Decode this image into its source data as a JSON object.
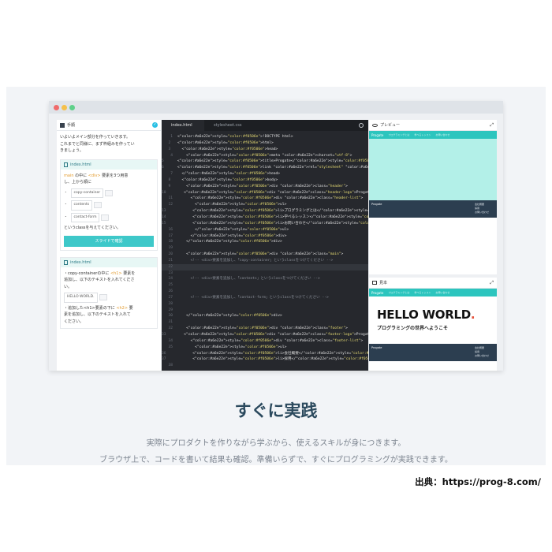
{
  "window": {
    "dots": [
      "#f06b6b",
      "#f5c04a",
      "#5fd08a"
    ]
  },
  "left": {
    "header": "手順",
    "intro": [
      "いよいよメイン部分を作っていきます。",
      "これまでと同様に、まず枠組みを作ってい",
      "きましょう。"
    ],
    "card1": {
      "file": "index.html",
      "line1a": "main",
      "line1b": " の中に ",
      "line1c": "<div>",
      "line1d": " 要素を3つ用意",
      "line2": "し、上から順に",
      "items": [
        "copy-container",
        "contents",
        "contact-form"
      ],
      "after": "というclassを与えてください。",
      "button": "スライドで確認"
    },
    "card2": {
      "file": "index.html",
      "l1a": "・copy-containerの中に ",
      "l1b": "<h1>",
      "l1c": " 要素を",
      "l2": "追加し、以下のテキストを入れてくださ",
      "l3": "い。",
      "hello": "HELLO WORLD.",
      "l4a": "・追加した<h1>要素の下に ",
      "l4b": "<h2>",
      "l4c": " 要",
      "l5": "素を追加し、以下のテキストを入れて",
      "l6": "ください。"
    }
  },
  "editor": {
    "tabs": [
      "index.html",
      "stylesheet.css"
    ],
    "lines": [
      {
        "n": "1",
        "t": "<!DOCTYPE html>"
      },
      {
        "n": "2 ",
        "t": "<html>"
      },
      {
        "n": "3 ",
        "t": "  <head>"
      },
      {
        "n": "4",
        "t": "    <meta charset=\"utf-8\">"
      },
      {
        "n": "5",
        "t": "    <title>Progate</title>"
      },
      {
        "n": "6",
        "t": "    <link rel=\"stylesheet\" href=\"stylesheet.css\">"
      },
      {
        "n": "7",
        "t": "  </head>"
      },
      {
        "n": "8 ",
        "t": "  <body>"
      },
      {
        "n": "9 ",
        "t": "    <div class=\"header\">"
      },
      {
        "n": "10",
        "t": "      <div class=\"header-logo\">Progate</div>"
      },
      {
        "n": "11",
        "t": "      <div class=\"header-list\">"
      },
      {
        "n": "12",
        "t": "        <ul>"
      },
      {
        "n": "13",
        "t": "          <li>プログラミングとは</li>"
      },
      {
        "n": "14",
        "t": "          <li>学べるレッスン</li>"
      },
      {
        "n": "15",
        "t": "          <li>お問い合わせ</li>"
      },
      {
        "n": "16",
        "t": "        </ul>"
      },
      {
        "n": "17",
        "t": "      </div>"
      },
      {
        "n": "18",
        "t": "    </div>"
      },
      {
        "n": "19",
        "t": ""
      },
      {
        "n": "20",
        "t": "    <div class=\"main\">"
      },
      {
        "n": "21",
        "t": "      <!-- <div>要素を追加し、「copy-container」というclassをつけてください -->"
      },
      {
        "n": "22",
        "t": ""
      },
      {
        "n": "23",
        "t": ""
      },
      {
        "n": "24",
        "t": "      <!-- <div>要素を追加し、「contents」というclassをつけてください -->"
      },
      {
        "n": "25",
        "t": ""
      },
      {
        "n": "26",
        "t": ""
      },
      {
        "n": "27",
        "t": "      <!-- <div>要素を追加し、「contact-form」というclassをつけてください -->"
      },
      {
        "n": "28",
        "t": ""
      },
      {
        "n": "29",
        "t": ""
      },
      {
        "n": "30",
        "t": "    </div>"
      },
      {
        "n": "31",
        "t": ""
      },
      {
        "n": "32",
        "t": "    <div class=\"footer\">"
      },
      {
        "n": "33",
        "t": "      <div class=\"footer-logo\">Progate</div>"
      },
      {
        "n": "34",
        "t": "      <div class=\"footer-list\">"
      },
      {
        "n": "35",
        "t": "        <ul>"
      },
      {
        "n": "36",
        "t": "          <li>会社概要</li>"
      },
      {
        "n": "37",
        "t": "          <li>採用</li>"
      },
      {
        "n": "38",
        "t": ""
      }
    ]
  },
  "preview": {
    "header": "プレビュー",
    "logo": "Progate",
    "nav": [
      "プログラミングとは",
      "学べるレッスン",
      "お問い合わせ"
    ],
    "footer_logo": "Progate",
    "footer_links": [
      "会社概要",
      "採用",
      "お問い合わせ"
    ]
  },
  "sample": {
    "header": "見本",
    "logo": "Progate",
    "nav": [
      "プログラミングとは",
      "学べるレッスン",
      "お問い合わせ"
    ],
    "hello_text": "HELLO WORLD",
    "hello_dot": ".",
    "sub": "プログラミングの世界へようこそ",
    "footer_logo": "Progate",
    "footer_links": [
      "会社概要",
      "採用",
      "お問い合わせ"
    ]
  },
  "caption": {
    "heading": "すぐに実践",
    "line1": "実際にプロダクトを作りながら学ぶから、使えるスキルが身につきます。",
    "line2": "ブラウザ上で、コードを書いて結果も確認。準備いらずで、すぐにプログラミングが実践できます。"
  },
  "source": "出典：https://prog-8.com/"
}
